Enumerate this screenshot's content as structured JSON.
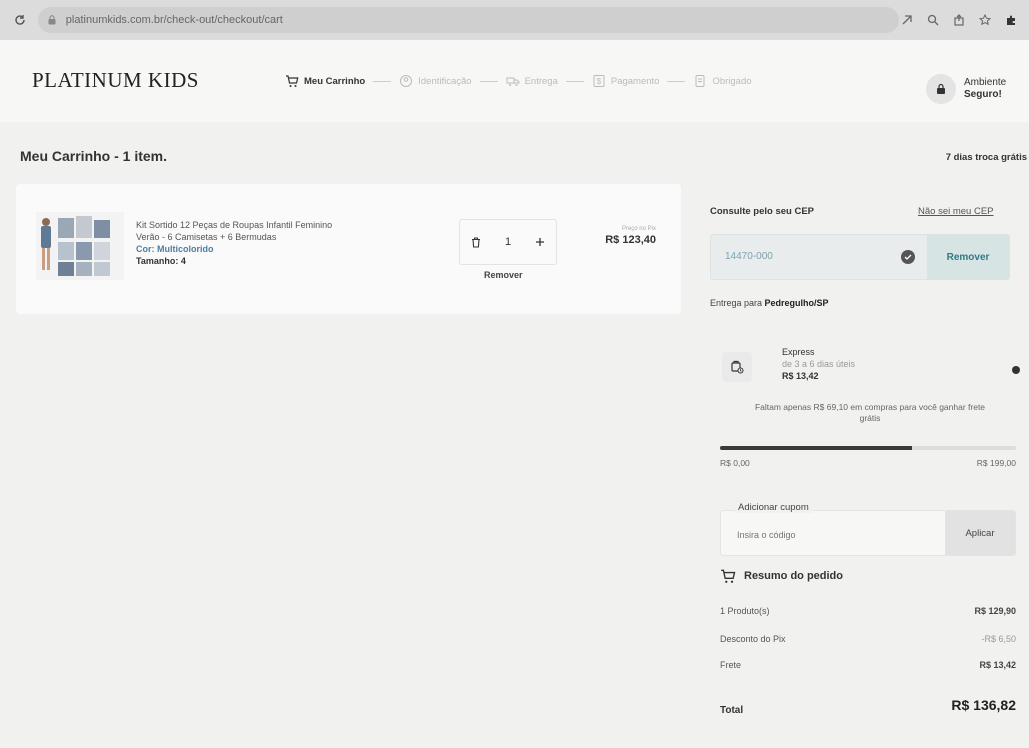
{
  "browser": {
    "url": "platinumkids.com.br/check-out/checkout/cart"
  },
  "header": {
    "logo": "PLATINUM KIDS",
    "steps": [
      {
        "label": "Meu Carrinho",
        "active": true
      },
      {
        "label": "Identificação",
        "active": false
      },
      {
        "label": "Entrega",
        "active": false
      },
      {
        "label": "Pagamento",
        "active": false
      },
      {
        "label": "Obrigado",
        "active": false
      }
    ],
    "secure_line1": "Ambiente",
    "secure_line2": "Seguro!"
  },
  "cart": {
    "title": "Meu Carrinho - 1 item.",
    "exchange_note": "7 dias troca grátis",
    "item": {
      "name_line1": "Kit Sortido 12 Peças de Roupas Infantil Feminino",
      "name_line2": "Verão - 6 Camisetas + 6 Bermudas",
      "color": "Cor: Multicolorido",
      "size": "Tamanho: 4",
      "quantity": "1",
      "remove_label": "Remover",
      "price_label": "Preço no Pix",
      "price": "R$ 123,40"
    }
  },
  "sidebar": {
    "cep_label": "Consulte pelo seu CEP",
    "cep_unknown": "Não sei meu CEP",
    "cep_value": "14470-000",
    "cep_remove": "Remover",
    "delivery_prefix": "Entrega para ",
    "delivery_city": "Pedregulho/SP",
    "shipping": {
      "name": "Express",
      "days": "de 3 a 6 dias úteis",
      "price": "R$ 13,42"
    },
    "free_shipping_msg": "Faltam apenas R$ 69,10 em compras para você ganhar frete grátis",
    "progress": {
      "min": "R$ 0,00",
      "max": "R$ 199,00",
      "fraction": 0.65
    },
    "coupon": {
      "label": "Adicionar cupom",
      "placeholder": "Insira o código",
      "apply": "Aplicar"
    },
    "summary": {
      "title": "Resumo do pedido",
      "rows": [
        {
          "label": "1 Produto(s)",
          "value": "R$ 129,90"
        },
        {
          "label": "Desconto do Pix",
          "value": "-R$ 6,50"
        },
        {
          "label": "Frete",
          "value": "R$ 13,42"
        }
      ],
      "total_label": "Total",
      "total_value": "R$ 136,82"
    }
  }
}
